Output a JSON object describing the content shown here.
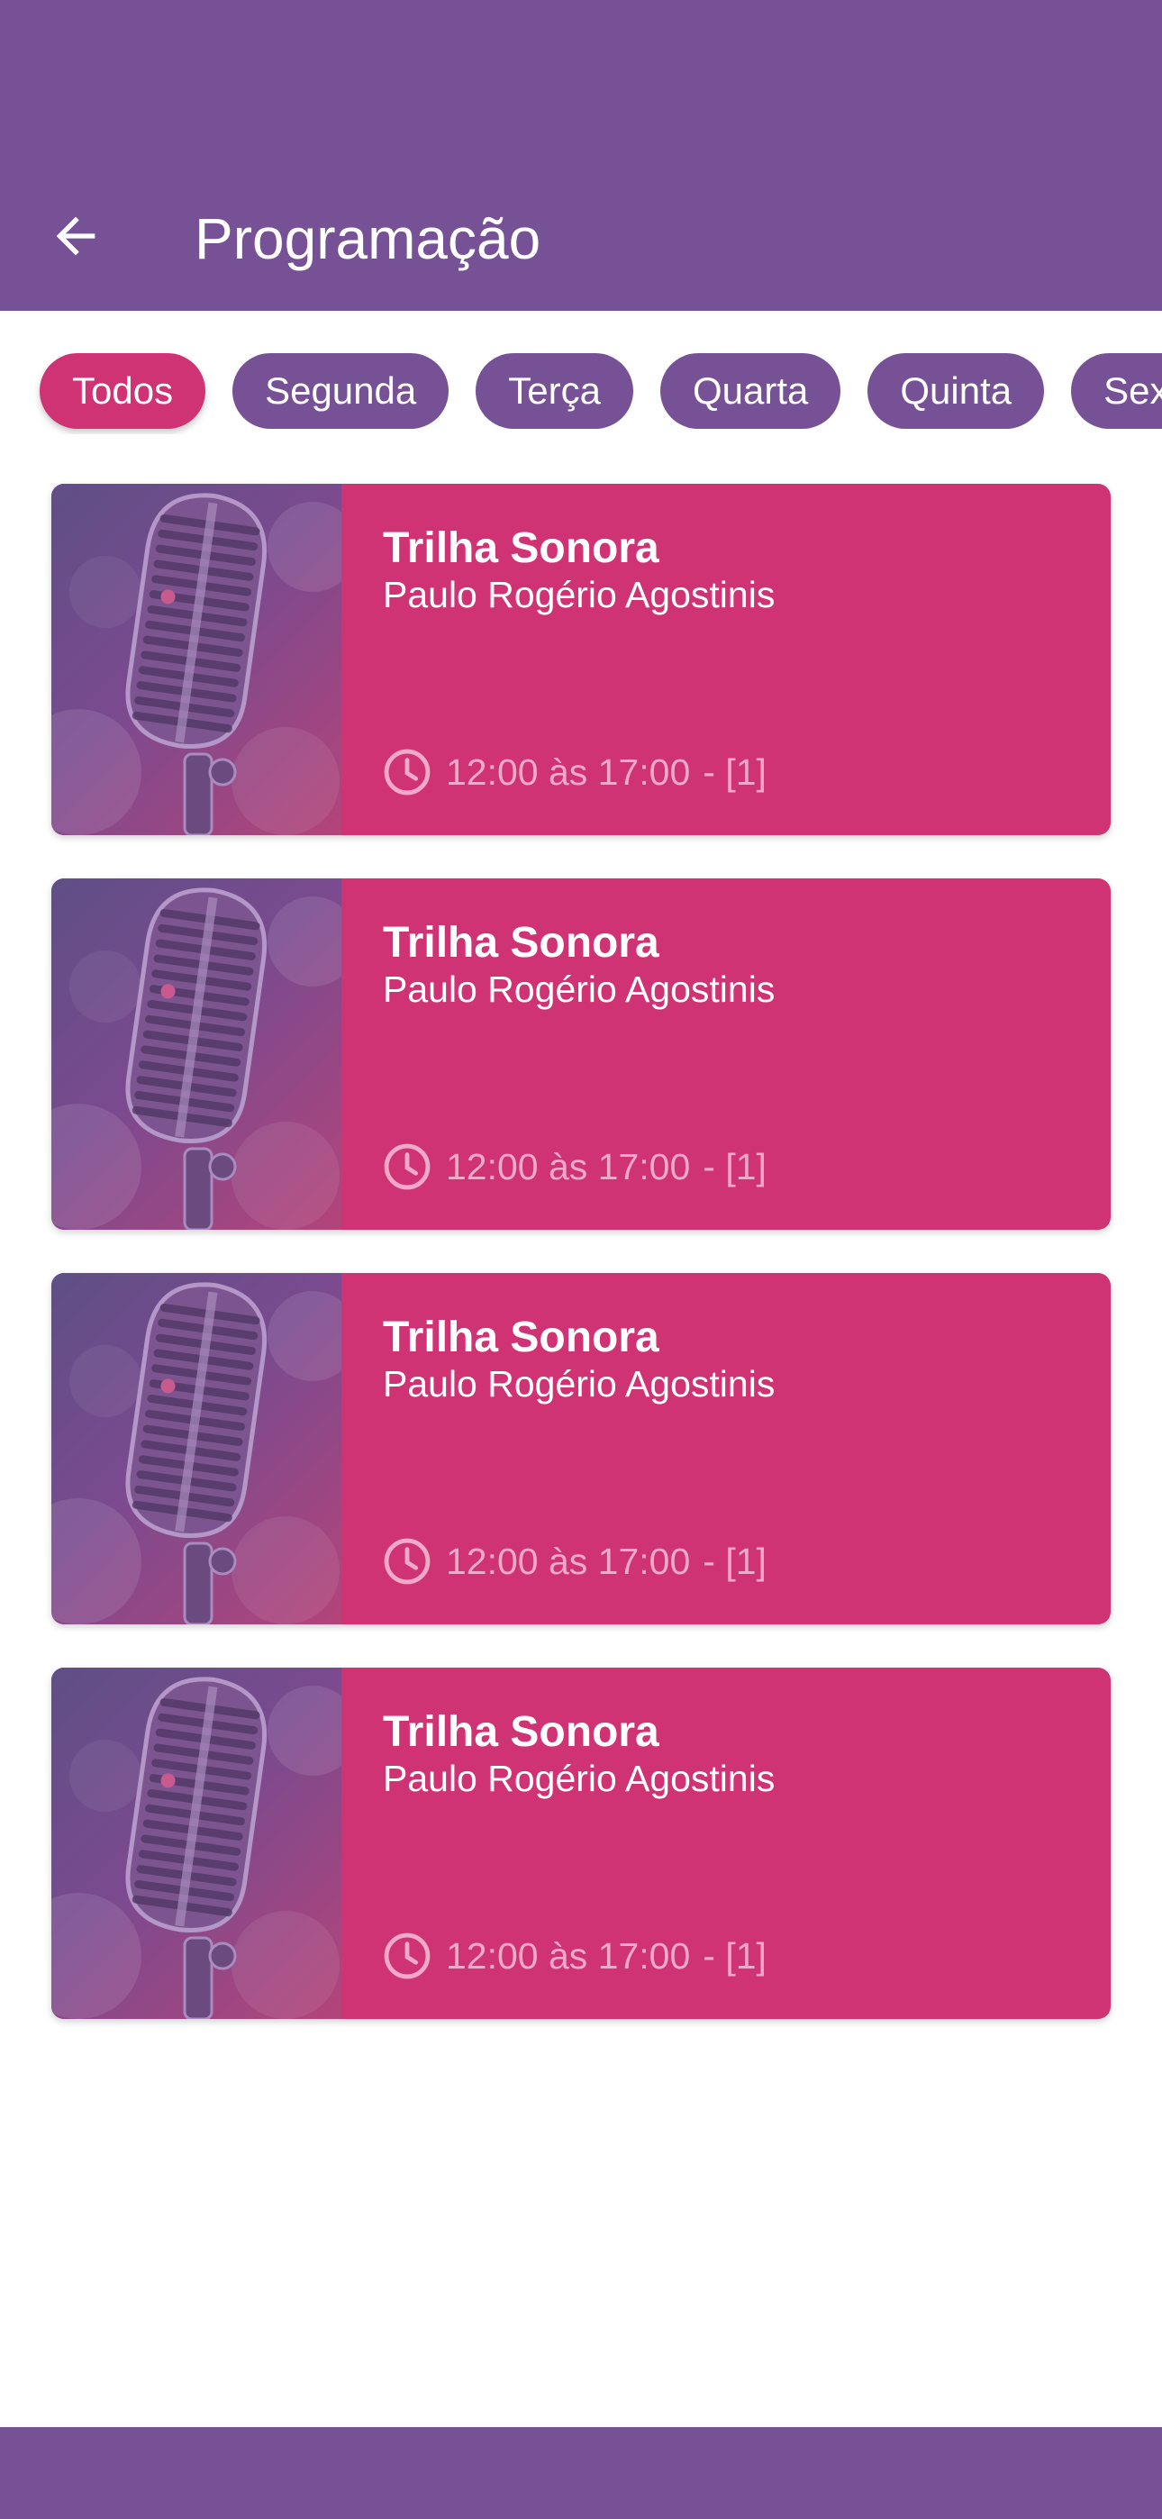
{
  "header": {
    "title": "Programação",
    "back_icon": "arrow-left-icon"
  },
  "colors": {
    "primary": "#765196",
    "accent": "#cf3374",
    "time_text": "#f0a9c8"
  },
  "day_tabs": [
    {
      "label": "Todos",
      "active": true
    },
    {
      "label": "Segunda",
      "active": false
    },
    {
      "label": "Terça",
      "active": false
    },
    {
      "label": "Quarta",
      "active": false
    },
    {
      "label": "Quinta",
      "active": false
    },
    {
      "label": "Sext",
      "active": false
    }
  ],
  "programs": [
    {
      "title": "Trilha Sonora",
      "host": "Paulo Rogério Agostinis",
      "time": "12:00 às 17:00",
      "count": "- [1]",
      "image": "microphone-image"
    },
    {
      "title": "Trilha Sonora",
      "host": "Paulo Rogério Agostinis",
      "time": "12:00 às 17:00",
      "count": "- [1]",
      "image": "microphone-image"
    },
    {
      "title": "Trilha Sonora",
      "host": "Paulo Rogério Agostinis",
      "time": "12:00 às 17:00",
      "count": "- [1]",
      "image": "microphone-image"
    },
    {
      "title": "Trilha Sonora",
      "host": "Paulo Rogério Agostinis",
      "time": "12:00 às 17:00",
      "count": "- [1]",
      "image": "microphone-image"
    }
  ]
}
